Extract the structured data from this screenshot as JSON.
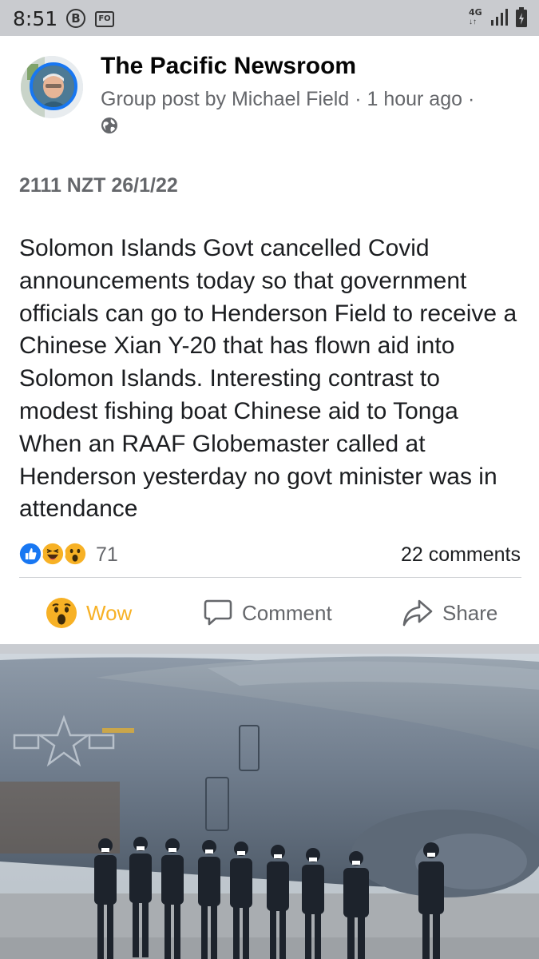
{
  "status_bar": {
    "time": "8:51",
    "b_badge": "B",
    "fm_badge": "FO",
    "network": "4G",
    "network_arrows": "↓↑",
    "icons": [
      "b-badge-icon",
      "radio-icon",
      "signal-icon",
      "battery-icon"
    ]
  },
  "post": {
    "group_name": "The Pacific Newsroom",
    "meta": "Group post by Michael Field · 1 hour ago ·",
    "privacy_icon": "globe-icon",
    "timestamp_line": "2111 NZT 26/1/22",
    "body": "Solomon Islands Govt cancelled Covid announcements today so that government officials can go to Henderson Field to receive a Chinese Xian Y-20 that has flown aid into Solomon Islands. Interesting contrast to modest fishing boat  Chinese aid to Tonga When an RAAF Globemaster called at Henderson yesterday no govt minister was in attendance",
    "reactions": {
      "icons": [
        "like-icon",
        "haha-icon",
        "wow-icon"
      ],
      "count": "71"
    },
    "comments_count": "22 comments",
    "actions": {
      "wow_label": "Wow",
      "comment_label": "Comment",
      "share_label": "Share"
    },
    "colors": {
      "like_blue": "#1877f2",
      "wow_yellow": "#f7b125",
      "meta_grey": "#65676b"
    }
  }
}
